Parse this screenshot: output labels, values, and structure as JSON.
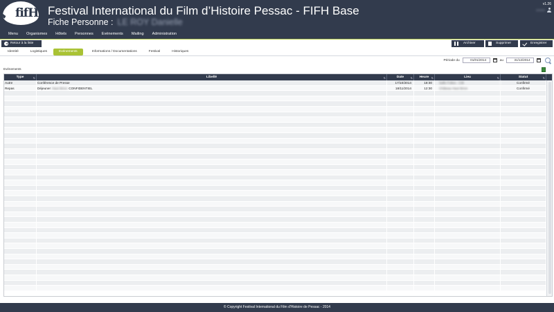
{
  "header": {
    "logo_text": "fifHi",
    "app_title": "Festival International du Film d’Histoire Pessac - FIFH Base",
    "subtitle_prefix": "Fiche Personne :",
    "subtitle_name": "LE ROY Danielle",
    "version": "v1.26",
    "user": "ADMIN"
  },
  "menu": [
    "Menu",
    "Organismes",
    "Hôtels",
    "Personnes",
    "Evénements",
    "Mailing",
    "Administration"
  ],
  "toolbar": {
    "back": "Retour à la liste",
    "archive": "Archiver",
    "delete": "Supprimer",
    "save": "Enregistrer"
  },
  "tabs": [
    "Identité",
    "Logistiques",
    "Evénements",
    "Informations / Documentations",
    "Festival",
    "Historiques"
  ],
  "active_tab": "Evénements",
  "period": {
    "label": "Période du",
    "start": "01/01/2014",
    "to": "au",
    "end": "31/12/2014"
  },
  "section_title": "Evénements",
  "table": {
    "columns": [
      "Type",
      "Libellé",
      "Date",
      "Heure",
      "Lieu",
      "Statut"
    ],
    "rows": [
      {
        "type": "Autre",
        "libelle": "Conférence de Presse",
        "libelle_blur": "",
        "libelle_suffix": "",
        "date": "17/10/2014",
        "heure": "18:30",
        "lieu": "Salle Folies - CiB",
        "statut": "Confirmé"
      },
      {
        "type": "Repas",
        "libelle": "Déjeuner",
        "libelle_blur": "Haut Brion",
        "libelle_suffix": "CONFIDENTIEL",
        "date": "18/11/2014",
        "heure": "12:30",
        "lieu": "Château Haut Brion",
        "statut": "Confirmé"
      }
    ]
  },
  "footer": "© Copyright Festival International du Film d'Histoire de Pessac - 2014",
  "colors": {
    "header_bg": "#323b4d",
    "accent_green": "#a9c234"
  }
}
